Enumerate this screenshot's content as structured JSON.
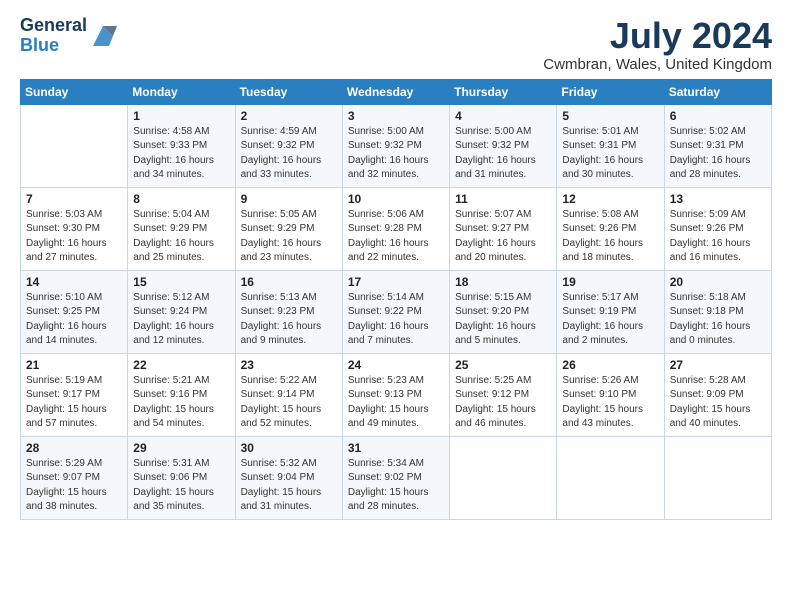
{
  "header": {
    "logo_general": "General",
    "logo_blue": "Blue",
    "title": "July 2024",
    "location": "Cwmbran, Wales, United Kingdom"
  },
  "weekdays": [
    "Sunday",
    "Monday",
    "Tuesday",
    "Wednesday",
    "Thursday",
    "Friday",
    "Saturday"
  ],
  "weeks": [
    [
      {
        "day": "",
        "info": ""
      },
      {
        "day": "1",
        "info": "Sunrise: 4:58 AM\nSunset: 9:33 PM\nDaylight: 16 hours\nand 34 minutes."
      },
      {
        "day": "2",
        "info": "Sunrise: 4:59 AM\nSunset: 9:32 PM\nDaylight: 16 hours\nand 33 minutes."
      },
      {
        "day": "3",
        "info": "Sunrise: 5:00 AM\nSunset: 9:32 PM\nDaylight: 16 hours\nand 32 minutes."
      },
      {
        "day": "4",
        "info": "Sunrise: 5:00 AM\nSunset: 9:32 PM\nDaylight: 16 hours\nand 31 minutes."
      },
      {
        "day": "5",
        "info": "Sunrise: 5:01 AM\nSunset: 9:31 PM\nDaylight: 16 hours\nand 30 minutes."
      },
      {
        "day": "6",
        "info": "Sunrise: 5:02 AM\nSunset: 9:31 PM\nDaylight: 16 hours\nand 28 minutes."
      }
    ],
    [
      {
        "day": "7",
        "info": "Sunrise: 5:03 AM\nSunset: 9:30 PM\nDaylight: 16 hours\nand 27 minutes."
      },
      {
        "day": "8",
        "info": "Sunrise: 5:04 AM\nSunset: 9:29 PM\nDaylight: 16 hours\nand 25 minutes."
      },
      {
        "day": "9",
        "info": "Sunrise: 5:05 AM\nSunset: 9:29 PM\nDaylight: 16 hours\nand 23 minutes."
      },
      {
        "day": "10",
        "info": "Sunrise: 5:06 AM\nSunset: 9:28 PM\nDaylight: 16 hours\nand 22 minutes."
      },
      {
        "day": "11",
        "info": "Sunrise: 5:07 AM\nSunset: 9:27 PM\nDaylight: 16 hours\nand 20 minutes."
      },
      {
        "day": "12",
        "info": "Sunrise: 5:08 AM\nSunset: 9:26 PM\nDaylight: 16 hours\nand 18 minutes."
      },
      {
        "day": "13",
        "info": "Sunrise: 5:09 AM\nSunset: 9:26 PM\nDaylight: 16 hours\nand 16 minutes."
      }
    ],
    [
      {
        "day": "14",
        "info": "Sunrise: 5:10 AM\nSunset: 9:25 PM\nDaylight: 16 hours\nand 14 minutes."
      },
      {
        "day": "15",
        "info": "Sunrise: 5:12 AM\nSunset: 9:24 PM\nDaylight: 16 hours\nand 12 minutes."
      },
      {
        "day": "16",
        "info": "Sunrise: 5:13 AM\nSunset: 9:23 PM\nDaylight: 16 hours\nand 9 minutes."
      },
      {
        "day": "17",
        "info": "Sunrise: 5:14 AM\nSunset: 9:22 PM\nDaylight: 16 hours\nand 7 minutes."
      },
      {
        "day": "18",
        "info": "Sunrise: 5:15 AM\nSunset: 9:20 PM\nDaylight: 16 hours\nand 5 minutes."
      },
      {
        "day": "19",
        "info": "Sunrise: 5:17 AM\nSunset: 9:19 PM\nDaylight: 16 hours\nand 2 minutes."
      },
      {
        "day": "20",
        "info": "Sunrise: 5:18 AM\nSunset: 9:18 PM\nDaylight: 16 hours\nand 0 minutes."
      }
    ],
    [
      {
        "day": "21",
        "info": "Sunrise: 5:19 AM\nSunset: 9:17 PM\nDaylight: 15 hours\nand 57 minutes."
      },
      {
        "day": "22",
        "info": "Sunrise: 5:21 AM\nSunset: 9:16 PM\nDaylight: 15 hours\nand 54 minutes."
      },
      {
        "day": "23",
        "info": "Sunrise: 5:22 AM\nSunset: 9:14 PM\nDaylight: 15 hours\nand 52 minutes."
      },
      {
        "day": "24",
        "info": "Sunrise: 5:23 AM\nSunset: 9:13 PM\nDaylight: 15 hours\nand 49 minutes."
      },
      {
        "day": "25",
        "info": "Sunrise: 5:25 AM\nSunset: 9:12 PM\nDaylight: 15 hours\nand 46 minutes."
      },
      {
        "day": "26",
        "info": "Sunrise: 5:26 AM\nSunset: 9:10 PM\nDaylight: 15 hours\nand 43 minutes."
      },
      {
        "day": "27",
        "info": "Sunrise: 5:28 AM\nSunset: 9:09 PM\nDaylight: 15 hours\nand 40 minutes."
      }
    ],
    [
      {
        "day": "28",
        "info": "Sunrise: 5:29 AM\nSunset: 9:07 PM\nDaylight: 15 hours\nand 38 minutes."
      },
      {
        "day": "29",
        "info": "Sunrise: 5:31 AM\nSunset: 9:06 PM\nDaylight: 15 hours\nand 35 minutes."
      },
      {
        "day": "30",
        "info": "Sunrise: 5:32 AM\nSunset: 9:04 PM\nDaylight: 15 hours\nand 31 minutes."
      },
      {
        "day": "31",
        "info": "Sunrise: 5:34 AM\nSunset: 9:02 PM\nDaylight: 15 hours\nand 28 minutes."
      },
      {
        "day": "",
        "info": ""
      },
      {
        "day": "",
        "info": ""
      },
      {
        "day": "",
        "info": ""
      }
    ]
  ]
}
